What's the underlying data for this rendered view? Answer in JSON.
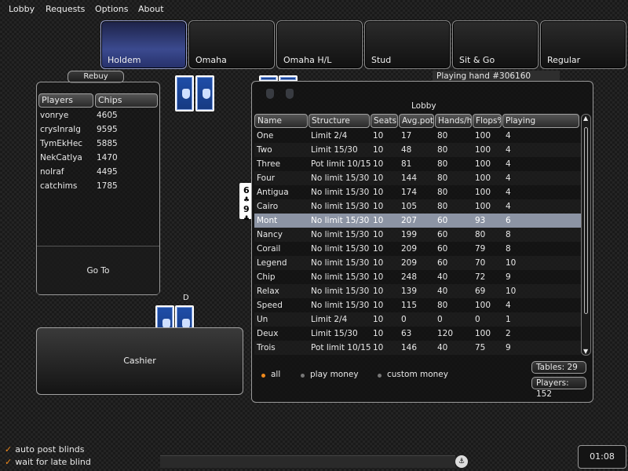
{
  "menu": [
    {
      "label": "Lobby",
      "key": "L"
    },
    {
      "label": "Requests",
      "key": "R"
    },
    {
      "label": "Options",
      "key": "O"
    },
    {
      "label": "About",
      "key": "A"
    }
  ],
  "categories": [
    "Holdem",
    "Omaha",
    "Omaha H/L",
    "Stud",
    "Sit & Go",
    "Regular"
  ],
  "active_category": "Holdem",
  "rebuy_label": "Rebuy",
  "playing_hand": "Playing hand #306160",
  "players": {
    "headers": [
      "Players",
      "Chips"
    ],
    "rows": [
      {
        "name": "vonrye",
        "chips": "4605"
      },
      {
        "name": "crysInralg",
        "chips": "9595"
      },
      {
        "name": "TymEkHec",
        "chips": "5885"
      },
      {
        "name": "NekCatlya",
        "chips": "1470"
      },
      {
        "name": "nolraf",
        "chips": "4495"
      },
      {
        "name": "catchims",
        "chips": "1785"
      }
    ],
    "goto_label": "Go To"
  },
  "cashier_label": "Cashier",
  "dealer_label": "D",
  "lobby": {
    "title": "Lobby",
    "headers": [
      "Name",
      "Structure",
      "Seats",
      "Avg.pot",
      "Hands/h",
      "Flops%",
      "Playing"
    ],
    "rows": [
      [
        "One",
        "Limit 2/4",
        "10",
        "17",
        "80",
        "100",
        "4"
      ],
      [
        "Two",
        "Limit 15/30",
        "10",
        "48",
        "80",
        "100",
        "4"
      ],
      [
        "Three",
        "Pot limit 10/15",
        "10",
        "81",
        "80",
        "100",
        "4"
      ],
      [
        "Four",
        "No limit 15/30",
        "10",
        "144",
        "80",
        "100",
        "4"
      ],
      [
        "Antigua",
        "No limit 15/30",
        "10",
        "174",
        "80",
        "100",
        "4"
      ],
      [
        "Cairo",
        "No limit 15/30",
        "10",
        "105",
        "80",
        "100",
        "4"
      ],
      [
        "Mont",
        "No limit 15/30",
        "10",
        "207",
        "60",
        "93",
        "6"
      ],
      [
        "Nancy",
        "No limit 15/30",
        "10",
        "199",
        "60",
        "80",
        "8"
      ],
      [
        "Corail",
        "No limit 15/30",
        "10",
        "209",
        "60",
        "79",
        "8"
      ],
      [
        "Legend",
        "No limit 15/30",
        "10",
        "209",
        "60",
        "70",
        "10"
      ],
      [
        "Chip",
        "No limit 15/30",
        "10",
        "248",
        "40",
        "72",
        "9"
      ],
      [
        "Relax",
        "No limit 15/30",
        "10",
        "139",
        "40",
        "69",
        "10"
      ],
      [
        "Speed",
        "No limit 15/30",
        "10",
        "115",
        "80",
        "100",
        "4"
      ],
      [
        "Un",
        "Limit 2/4",
        "10",
        "0",
        "0",
        "0",
        "1"
      ],
      [
        "Deux",
        "Limit 15/30",
        "10",
        "63",
        "120",
        "100",
        "2"
      ],
      [
        "Trois",
        "Pot limit 10/15",
        "10",
        "146",
        "40",
        "75",
        "9"
      ]
    ],
    "selected_row": "Mont",
    "filters": [
      "all",
      "play money",
      "custom money"
    ],
    "active_filter": "all",
    "tables": "Tables: 29",
    "players_count": "Players: 152"
  },
  "visible_card_ranks": [
    "6",
    "9"
  ],
  "options": [
    {
      "label": "auto post blinds",
      "checked": true
    },
    {
      "label": "wait for late blind",
      "checked": true
    }
  ],
  "clock": "01:08",
  "colors": {
    "accent_orange": "#f08a1c",
    "selected_row": "#8c94a4",
    "active_tab": "#3b4a8f"
  }
}
